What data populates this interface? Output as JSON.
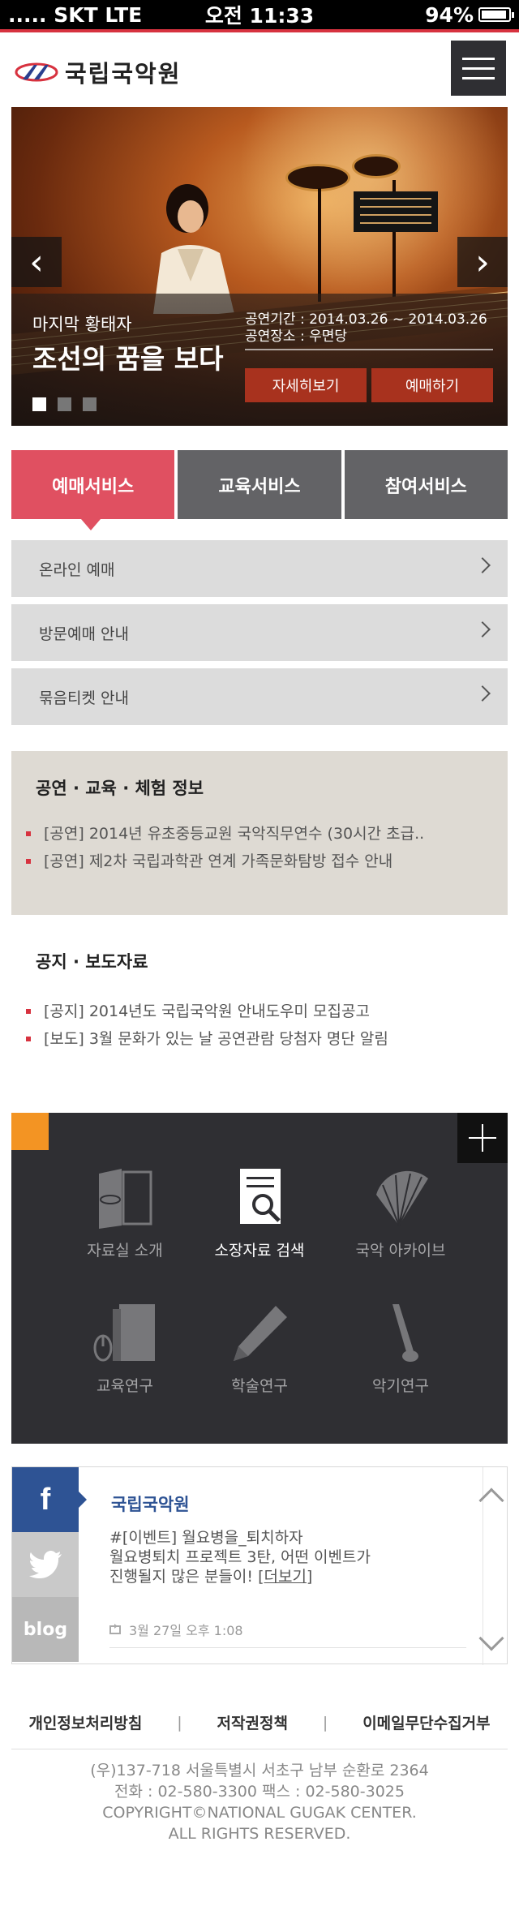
{
  "status": {
    "carrier": "..... SKT  LTE",
    "time": "오전 11:33",
    "battery": "94%",
    "battery_level": 0.94
  },
  "header": {
    "logo_text": "국립국악원"
  },
  "hero": {
    "subtitle": "마지막 황태자",
    "title": "조선의 꿈을 보다",
    "period": "공연기간 : 2014.03.26 ~ 2014.03.26",
    "venue": "공연장소 : 우면당",
    "detail_label": "자세히보기",
    "book_label": "예매하기",
    "slides": 3,
    "active_slide": 1
  },
  "tabs": [
    {
      "label": "예매서비스",
      "active": true
    },
    {
      "label": "교육서비스",
      "active": false
    },
    {
      "label": "참여서비스",
      "active": false
    }
  ],
  "services": [
    {
      "label": "온라인 예매"
    },
    {
      "label": "방문예매 안내"
    },
    {
      "label": "묶음티켓 안내"
    }
  ],
  "info": {
    "title": "공연 · 교육 · 체험 정보",
    "items": [
      "[공연] 2014년 유초중등교원 국악직무연수 (30시간 초급..",
      "[공연] 제2차 국립과학관 연계 가족문화탐방 접수 안내"
    ]
  },
  "notice": {
    "title": "공지 · 보도자료",
    "items": [
      "[공지] 2014년도 국립국악원 안내도우미 모집공고",
      "[보도] 3월 문화가 있는 날 공연관람 당첨자 명단 알림"
    ]
  },
  "archive": {
    "items": [
      {
        "label": "자료실 소개",
        "icon": "book-logo-icon"
      },
      {
        "label": "소장자료 검색",
        "icon": "document-search-icon",
        "active": true
      },
      {
        "label": "국악 아카이브",
        "icon": "fan-icon"
      },
      {
        "label": "교육연구",
        "icon": "mouse-book-icon"
      },
      {
        "label": "학술연구",
        "icon": "pencil-icon"
      },
      {
        "label": "악기연구",
        "icon": "flute-icon"
      }
    ]
  },
  "social": {
    "name": "국립국악원",
    "text_line1": "#[이벤트] 월요병을_퇴치하자",
    "text_line2": "월요병퇴치 프로젝트 3탄, 어떤 이벤트가",
    "text_line3": "진행될지 많은 분들이!",
    "more": "[더보기]",
    "time": "3월 27일 오후 1:08",
    "blog_label": "blog"
  },
  "footer": {
    "links": [
      "개인정보처리방침",
      "저작권정책",
      "이메일무단수집거부"
    ],
    "address": "(우)137-718 서울특별시 서초구 남부 순환로 2364",
    "phone": "전화 : 02-580-3300 팩스 : 02-580-3025",
    "copyright1": "COPYRIGHT©NATIONAL GUGAK CENTER.",
    "copyright2": "ALL RIGHTS RESERVED."
  },
  "colors": {
    "accent": "#e05061",
    "tab": "#636366",
    "panel": "#2f2f33",
    "orange": "#f39423",
    "facebook": "#2e5394",
    "brand_red": "#d7323f"
  }
}
